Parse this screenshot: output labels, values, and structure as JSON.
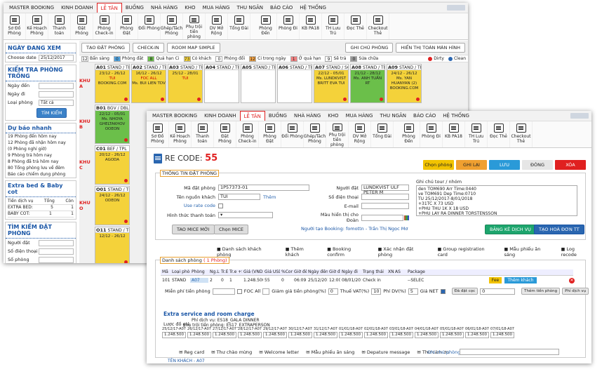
{
  "menu": [
    "MASTER BOOKING",
    "KINH DOANH",
    "LỄ TÂN",
    "BUỒNG",
    "NHÀ HÀNG",
    "KHO",
    "MUA HÀNG",
    "THU NGÂN",
    "BÁO CÁO",
    "HỆ THỐNG"
  ],
  "menu_active_index": 2,
  "toolbar": [
    "Sơ Đồ Phòng",
    "Kế Hoạch Phòng",
    "Thanh toán",
    "Đặt Phòng",
    "Phòng Check-in",
    "Phòng Đặt",
    "Đổi Phòng",
    "Ghép/Tách Phòng",
    "Phụ trội tiền phòng",
    "DV Mở Rộng",
    "Tổng Đài",
    "Phòng Đến",
    "Phòng Đi",
    "KB PA18",
    "TH Lưu Trú",
    "Đọc Thẻ",
    "Checkout Thẻ"
  ],
  "w1": {
    "side": {
      "ngay_title": "NGÀY ĐANG XEM",
      "choose_label": "Choose date",
      "choose_value": "25/12/2017",
      "kiem_title": "KIỂM TRA PHÒNG TRỐNG",
      "ngay_den": "Ngày đến",
      "ngay_di": "Ngày đi",
      "loai_phong": "Loại phòng",
      "loai_value": "Tất cả",
      "tim_kiem": "TÌM KIẾM",
      "forecast_title": "Dự báo nhanh",
      "forecast": [
        "19 Phòng đến hôm nay",
        "12 Phòng đã nhận hôm nay",
        "(0 Phòng nghỉ giờ)",
        "9 Phòng trả hôm nay",
        "8 Phòng đã trả hôm nay",
        "80 Tổng phòng lưu về đêm",
        "Báo cáo chiếm dụng phòng"
      ],
      "extra_title": "Extra bed & Baby cot",
      "extra_head": [
        "Tiền dịch vụ",
        "Tổng",
        "Còn"
      ],
      "extra_rows": [
        [
          "EXTRA BED:",
          "5",
          "1"
        ],
        [
          "BABY COT:",
          "1",
          "1"
        ]
      ],
      "search_title": "TÌM KIẾM ĐẶT PHÒNG",
      "nguoi_dat": "Người đặt",
      "so_dien_thoai": "Số điện thoại",
      "so_phong": "Số phòng"
    },
    "actions": [
      "TẠO ĐẶT PHÒNG",
      "CHECK-IN",
      "ROOM MAP SIMPLE",
      "GHI CHÚ PHÒNG",
      "HIỂN THỊ TOÀN MÀN HÌNH"
    ],
    "legend": [
      {
        "n": "12",
        "t": "Bẩn sàng",
        "c": "#ffffff"
      },
      {
        "n": "0",
        "t": "Phòng đặt",
        "c": "#4fa3e0"
      },
      {
        "n": "8",
        "t": "Quá hạn Ci",
        "c": "#6bbf4a"
      },
      {
        "n": "73",
        "t": "Có khách",
        "c": "#f4d23a"
      },
      {
        "n": "0",
        "t": "Phòng đổi",
        "c": "#ffffff"
      },
      {
        "n": "12",
        "t": "Ci trong ngày",
        "c": "#f0a040"
      },
      {
        "n": "1",
        "t": "Ở quá hạn",
        "c": "#f08080"
      },
      {
        "n": "9",
        "t": "Sẽ trả",
        "c": "#ffffff"
      },
      {
        "n": "0",
        "t": "Sửa chữa",
        "c": "#999999"
      }
    ],
    "dirty": "Dirty",
    "clean": "Clean",
    "zones": [
      {
        "label": "KHU A",
        "rooms": [
          {
            "code": "A01",
            "type": "STAND / TPL",
            "dates": "23/12 - 26/12",
            "ref": "TUI",
            "who": "BOOKING.COM",
            "cls": "y"
          },
          {
            "code": "A02",
            "type": "STAND / TPL",
            "dates": "16/12 - 26/12",
            "ref": "FOC ALL",
            "who": "Ms. BUI LIEN TDV",
            "cls": "y"
          },
          {
            "code": "A03",
            "type": "STAND / TPL",
            "dates": "25/12 - 28/01",
            "ref": "TUI",
            "who": "",
            "cls": "y"
          },
          {
            "code": "A04",
            "type": "STAND / TPL",
            "dates": "",
            "ref": "",
            "who": "",
            "cls": "w"
          },
          {
            "code": "A05",
            "type": "STAND / TPL",
            "dates": "",
            "ref": "",
            "who": "",
            "cls": "w"
          },
          {
            "code": "A06",
            "type": "STAND / TPL",
            "dates": "",
            "ref": "",
            "who": "",
            "cls": "w"
          },
          {
            "code": "A07",
            "type": "STAND / SGL",
            "dates": "22/12 - 05/01",
            "ref": "",
            "who": "Ms. LUNDKVIST BRITT EVA TUI",
            "cls": "y"
          },
          {
            "code": "A08",
            "type": "STAND / TPL",
            "dates": "21/12 - 28/12",
            "ref": "",
            "who": "Ms. ANH TUẤN RT",
            "cls": "g"
          },
          {
            "code": "A09",
            "type": "STAND / TPL",
            "dates": "24/12 - 26/12",
            "ref": "",
            "who": "Ms. YAN HUANYAN (2) BOOKING.COM",
            "cls": "y"
          }
        ]
      },
      {
        "label": "KHU B",
        "rooms": [
          {
            "code": "B01",
            "type": "BGV / DBL",
            "dates": "22/12 - 05/01",
            "ref": "",
            "who": "Ms. NHOYA GHELTAKHOV OOEON",
            "cls": "g"
          }
        ]
      },
      {
        "label": "KHU C",
        "rooms": [
          {
            "code": "C01",
            "type": "BEF / TPL",
            "dates": "20/12 - 26/12",
            "ref": "",
            "who": "AGODA",
            "cls": "y"
          }
        ]
      },
      {
        "label": "KHU O",
        "rooms": [
          {
            "code": "O01",
            "type": "STAND / TPL",
            "dates": "24/12 - 26/12",
            "ref": "",
            "who": "ODEON",
            "cls": "y"
          }
        ]
      },
      {
        "label": "",
        "rooms": [
          {
            "code": "O11",
            "type": "STAND / TPL",
            "dates": "12/12 - 26/12",
            "ref": "",
            "who": "",
            "cls": "y"
          }
        ]
      }
    ]
  },
  "w2": {
    "re_code_label": "RE CODE:",
    "re_code": "55",
    "top_buttons": [
      {
        "t": "Chọn phòng",
        "c": "#f2c300",
        "fc": "#222"
      },
      {
        "t": "GHI LẠI",
        "c": "#f0a030",
        "fc": "#222"
      },
      {
        "t": "LƯU",
        "c": "#2a9ad8",
        "fc": "#fff"
      },
      {
        "t": "ĐÓNG",
        "c": "#e6e6e6",
        "fc": "#222"
      },
      {
        "t": "XÓA",
        "c": "#e02020",
        "fc": "#fff"
      }
    ],
    "info_title": "THÔNG TIN ĐẶT PHÒNG",
    "ma_dat_phong_label": "Mã đặt phòng",
    "ma_dat_phong": "1P57373-01",
    "ten_nguon_label": "Tên nguồn khách",
    "ten_nguon": "TUI",
    "them": "Thêm",
    "use_rate_code": "Use rate code",
    "hinh_thuc_label": "Hình thức thanh toán",
    "nguoi_dat_label": "Người đặt",
    "nguoi_dat": "LUNDKVIST ULF PETER M",
    "so_dt_label": "Số điện thoại",
    "email_label": "E-mail",
    "mau_hien_label": "Màu hiển thị cho Đoàn",
    "ghi_chu_label": "Ghi chú tour / nhóm",
    "ghi_chu_lines": [
      "den TOM690 Arr Time:0440",
      "ve TOM691 Dep Time:0710",
      "TU 25/12/2017-8/01/2018",
      "+31TC X 73 USD",
      "+PHU THU 1K X 18 USD",
      "+PHU LAY RA DINNER TORSTENSSON"
    ],
    "tao_mice": "TAO MICE MỚI",
    "chon_mice": "Chọn MICE",
    "nguoi_tao": "Người tạo Booking: fomottn - Trần Thị Ngọc Mơ",
    "bang_ke": "BẢNG KÊ DỊCH VỤ",
    "tao_hoa_don": "TẠO HOÁ ĐƠN TT",
    "links": [
      "Danh sách khách phòng",
      "Thêm khách",
      "Booking confirm",
      "Xác nhận đặt phòng",
      "Group registration card",
      "Mẫu phiếu ăn sáng",
      "Log recode"
    ],
    "ds_phong": "Danh sách phòng",
    "ds_count": "( 1 Phòng)",
    "grid_head": [
      "Mã",
      "Loại phòng",
      "Phòng",
      "Ng.L",
      "Tr.E",
      "Tr.e +Si",
      "Giá (VND)",
      "Giá USD",
      "%Com",
      "Giờ đến",
      "Ngày đến",
      "Giờ đi",
      "Ngày đi",
      "Trạng thái",
      "XN",
      "AS",
      "",
      "Package"
    ],
    "grid_row": [
      "101",
      "STAND",
      "A07",
      "2",
      "0",
      "1",
      "1.248.500",
      "55",
      "0",
      "06:09",
      "25/12/2017",
      "12:00",
      "08/01/2018",
      "Check in",
      "",
      "",
      "",
      "--SELEC"
    ],
    "fee_label": "Fee",
    "them_khach_btn": "Thêm khách",
    "mien_phi": "Miễn phí tiền phòng",
    "foc_all": "FOC All",
    "giam_gia": "Giảm giá tiền phòng(%)",
    "giam_gia_val": "0",
    "thue_vat": "Thuế VAT(%)",
    "thue_val": "10",
    "phi_dv": "Phí DV(%)",
    "phi_val": "5",
    "gia_net": "Giá NET",
    "da_dat_coc": "Đã đặt cọc",
    "coc_val": "0",
    "them_tien": "Thêm tiền phòng",
    "phi_dich_vu": "Phí dịch vụ",
    "extra_title": "Extra service and room charge",
    "extra_l1": "Phí dịch vụ: ES18_GALA DINNER",
    "extra_l2": "Phụ trội tiền phòng: ES17_EXTRAPERSON",
    "luoc_do": "Lược đồ giá",
    "prices": [
      {
        "d": "25/12/17-A07",
        "v": "1.248.500"
      },
      {
        "d": "26/12/17-A07",
        "v": "1.248.500"
      },
      {
        "d": "27/12/17-A07",
        "v": "1.248.500"
      },
      {
        "d": "28/12/17-A07",
        "v": "1.248.500"
      },
      {
        "d": "29/12/17-A07",
        "v": "1.248.500"
      },
      {
        "d": "30/12/17-A07",
        "v": "1.248.500"
      },
      {
        "d": "31/12/17-A07",
        "v": "1.248.500"
      },
      {
        "d": "01/01/18-A07",
        "v": "1.248.500"
      },
      {
        "d": "02/01/18-A07",
        "v": "1.248.500"
      },
      {
        "d": "03/01/18-A07",
        "v": "1.248.500"
      },
      {
        "d": "04/01/18-A07",
        "v": "1.248.500"
      },
      {
        "d": "05/01/18-A07",
        "v": "1.248.500"
      },
      {
        "d": "06/01/18-A07",
        "v": "1.248.500"
      },
      {
        "d": "07/01/18-A07",
        "v": "1.248.500"
      }
    ],
    "bottom_links": [
      "Reg card",
      "Thư chào mừng",
      "Welcome letter",
      "Mẫu phiếu ăn sáng",
      "Depature message",
      "Thư cảm ơn"
    ],
    "ghi_chu_phong": "Ghi chú phòng",
    "ten_khach": "TÊN KHÁCH - A07"
  }
}
